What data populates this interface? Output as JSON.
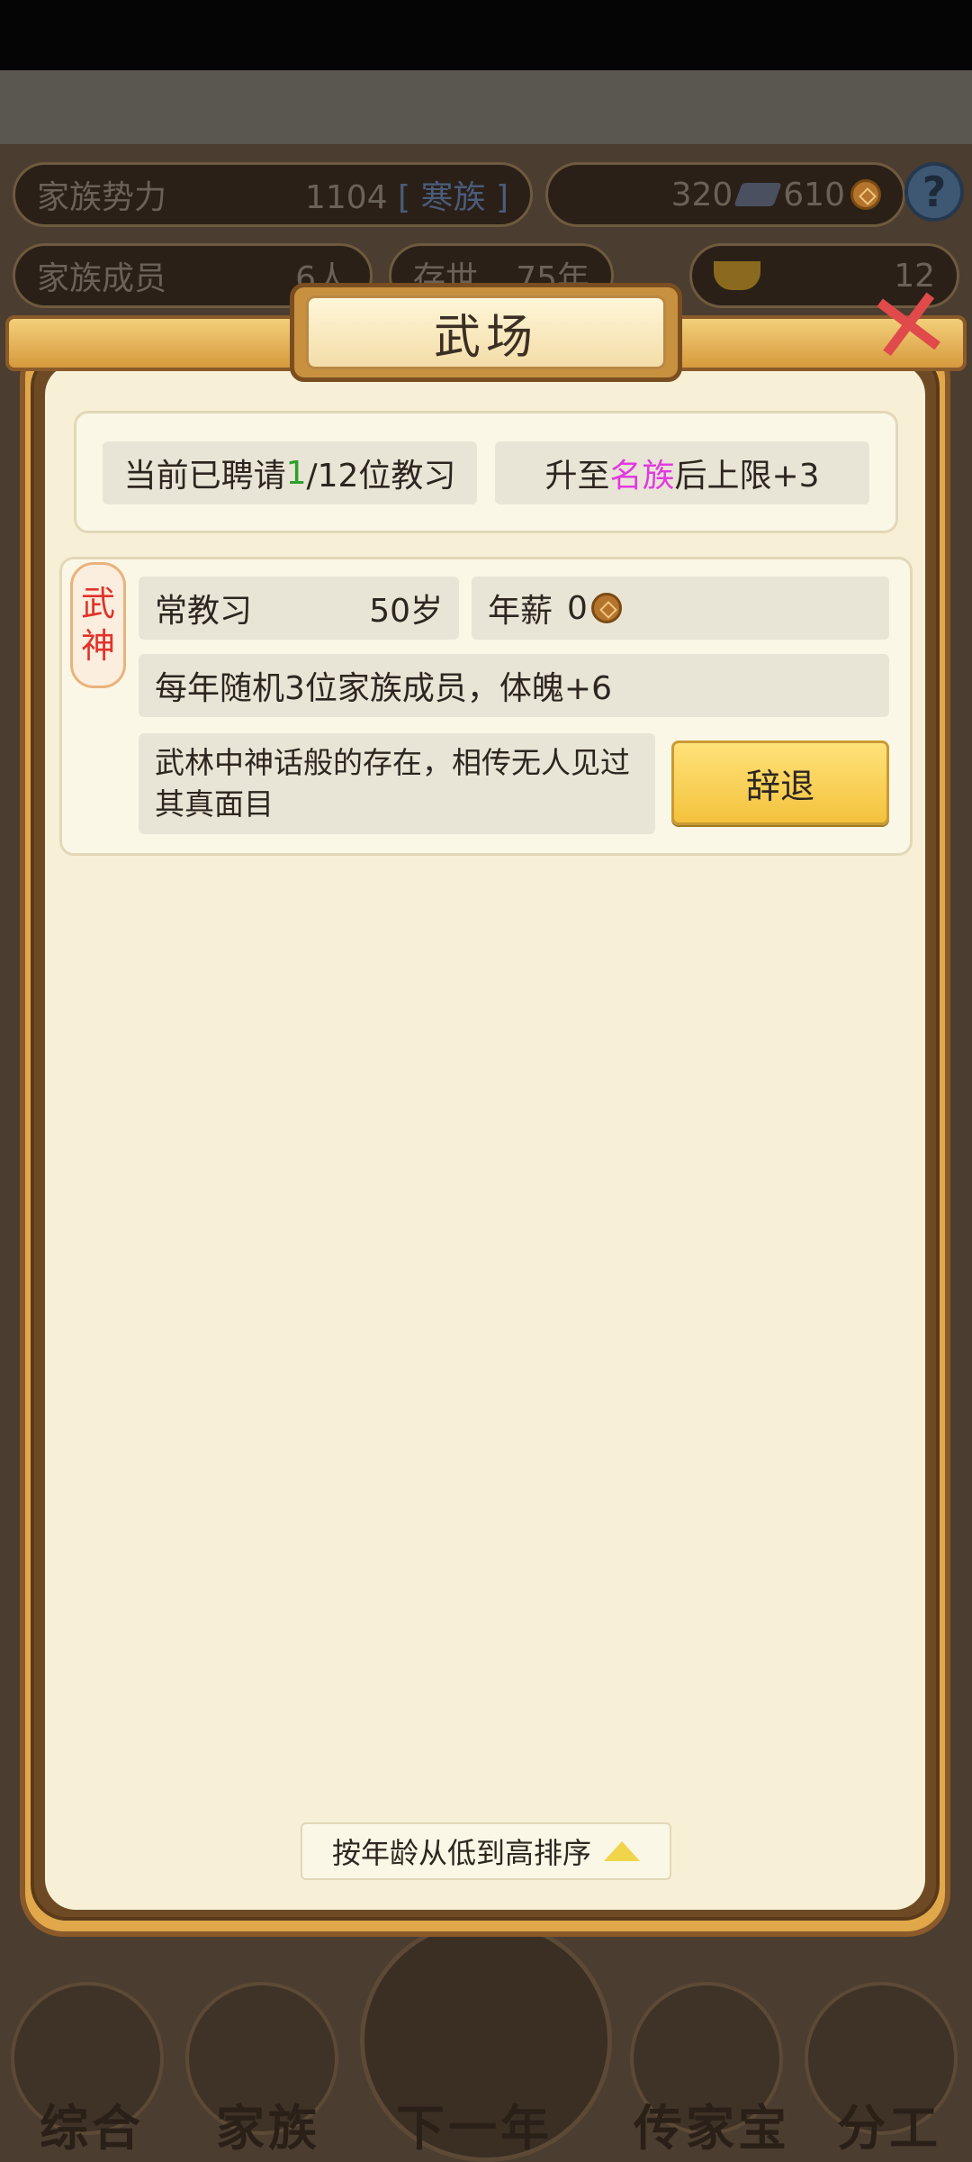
{
  "hud": {
    "power_label": "家族势力",
    "power_value": "1104",
    "power_rank": "[ 寒族 ]",
    "ticket_amount": "320",
    "coin_amount": "610",
    "members_label": "家族成员",
    "members_value": "6人",
    "era_label": "存世",
    "era_value": "75年",
    "gold_amount": "12"
  },
  "dialog": {
    "title": "武场",
    "hired_prefix": "当前已聘请",
    "hired_count": "1",
    "hired_suffix": "/12位教习",
    "upgrade_prefix": "升至",
    "upgrade_rank": "名族",
    "upgrade_suffix": "后上限+3",
    "sort_label": "按年龄从低到高排序"
  },
  "instructor": {
    "tag_line1": "武",
    "tag_line2": "神",
    "title": "常教习",
    "age": "50岁",
    "salary_label": "年薪",
    "salary_value": "0",
    "effect": "每年随机3位家族成员，体魄+6",
    "description": "武林中神话般的存在，相传无人见过其真面目",
    "dismiss_label": "辞退"
  },
  "nav": {
    "items": [
      "综合",
      "家族",
      "下一年",
      "传家宝",
      "分工"
    ]
  },
  "colors": {
    "highlight_green": "#2ba02b",
    "highlight_pink": "#e23ae0",
    "tag_red": "#e0332b",
    "dismiss_gold": "#f3c23c"
  }
}
